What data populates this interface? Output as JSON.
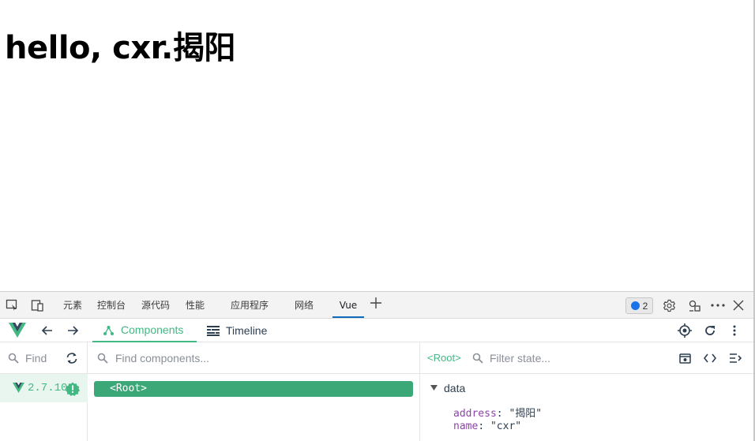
{
  "page": {
    "heading": "hello, cxr.揭阳"
  },
  "devtools": {
    "tabs": [
      "元素",
      "控制台",
      "源代码",
      "性能",
      "应用程序",
      "网络",
      "Vue"
    ],
    "active_tab": "Vue",
    "issues_count": "2",
    "icons": [
      "inspect-element-icon",
      "device-emulation-icon",
      "plus-icon",
      "issues-icon",
      "settings-icon",
      "customize-icon",
      "more-icon",
      "close-icon"
    ]
  },
  "vue": {
    "tabs": {
      "components": "Components",
      "timeline": "Timeline"
    },
    "left": {
      "find_placeholder": "Find",
      "version": "2.7.10"
    },
    "middle": {
      "search_placeholder": "Find components...",
      "root_label": "<Root>"
    },
    "right": {
      "root_tag": "<Root>",
      "filter_placeholder": "Filter state...",
      "section_label": "data",
      "props": [
        {
          "key": "address",
          "value": "\"揭阳\""
        },
        {
          "key": "name",
          "value": "\"cxr\""
        }
      ]
    },
    "colors": {
      "accent": "#42b883",
      "root_bar": "#3ca877",
      "prop_key": "#8e44ad"
    }
  }
}
